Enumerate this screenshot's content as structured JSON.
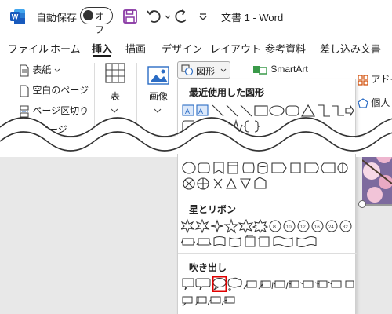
{
  "titlebar": {
    "autosave_label": "自動保存",
    "toggle_state": "オフ",
    "doc_title": "文書 1  -  Word"
  },
  "tabs": [
    "ファイル",
    "ホーム",
    "挿入",
    "描画",
    "デザイン",
    "レイアウト",
    "参考資料",
    "差し込み文書"
  ],
  "active_tab": "挿入",
  "ribbon": {
    "cover_page": "表紙",
    "blank_page": "空白のページ",
    "page_break": "ページ区切り",
    "pages_group": "ページ",
    "table_label": "表",
    "table_group": "表",
    "image_label": "画像",
    "shapes_button": "図形",
    "smartart": "SmartArt",
    "addins_partial": "アドイ",
    "personal_partial": "個人"
  },
  "shapes_panel": {
    "recent_title": "最近使用した図形",
    "stars_title": "星とリボン",
    "callouts_title": "吹き出し"
  },
  "colors": {
    "accent_red": "#e00000",
    "word_blue": "#185abd",
    "shape_blue": "#2b6cc4",
    "purple": "#8a3aa5"
  }
}
